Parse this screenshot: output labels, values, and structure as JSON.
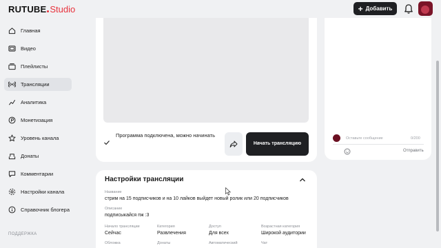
{
  "header": {
    "logo_main": "RUTUBE",
    "logo_studio": "Studio",
    "add_button_label": "Добавить",
    "add_button_icon": "plus-icon",
    "notifications_icon": "bell-icon"
  },
  "sidebar": {
    "items": [
      {
        "label": "Главная",
        "icon": "home-icon"
      },
      {
        "label": "Видео",
        "icon": "video-icon"
      },
      {
        "label": "Плейлисты",
        "icon": "playlist-icon"
      },
      {
        "label": "Трансляции",
        "icon": "broadcast-icon",
        "active": true
      },
      {
        "label": "Аналитика",
        "icon": "analytics-icon"
      },
      {
        "label": "Монетизация",
        "icon": "monetization-icon"
      },
      {
        "label": "Уровень канала",
        "icon": "level-icon"
      },
      {
        "label": "Донаты",
        "icon": "donations-icon"
      },
      {
        "label": "Комментарии",
        "icon": "comments-icon"
      },
      {
        "label": "Настройки канала",
        "icon": "settings-icon"
      },
      {
        "label": "Справочник блогера",
        "icon": "info-icon"
      }
    ],
    "support_section_title": "ПОДДЕРЖКА"
  },
  "stream": {
    "status_text": "Программа подключена, можно начинать",
    "start_button_label": "Начать трансляцию"
  },
  "chat": {
    "input_placeholder": "Оставьте сообщение",
    "char_count": "0/200",
    "send_label": "Отправить"
  },
  "settings": {
    "title": "Настройки трансляции",
    "name_label": "Название",
    "name_value": "стрим на 15 подписчиков и на 10 лайков выйдет новый ролик или 20 подписчиков",
    "description_label": "Описание",
    "description_value": "подписыкайся пж :3",
    "start_label": "Начало трансляции",
    "start_value": "Сейчас",
    "category_label": "Категория",
    "category_value": "Развлечения",
    "access_label": "Доступ",
    "access_value": "Для всех",
    "age_label": "Возрастная категория",
    "age_value": "Широкой аудитории",
    "cover_label": "Обложка",
    "donations_label": "Донаты",
    "auto_label": "Автоматический",
    "chat_label": "Чат"
  },
  "colors": {
    "accent": "#e8323c",
    "dark_button": "#1f2023",
    "background": "#f0f1f3"
  }
}
